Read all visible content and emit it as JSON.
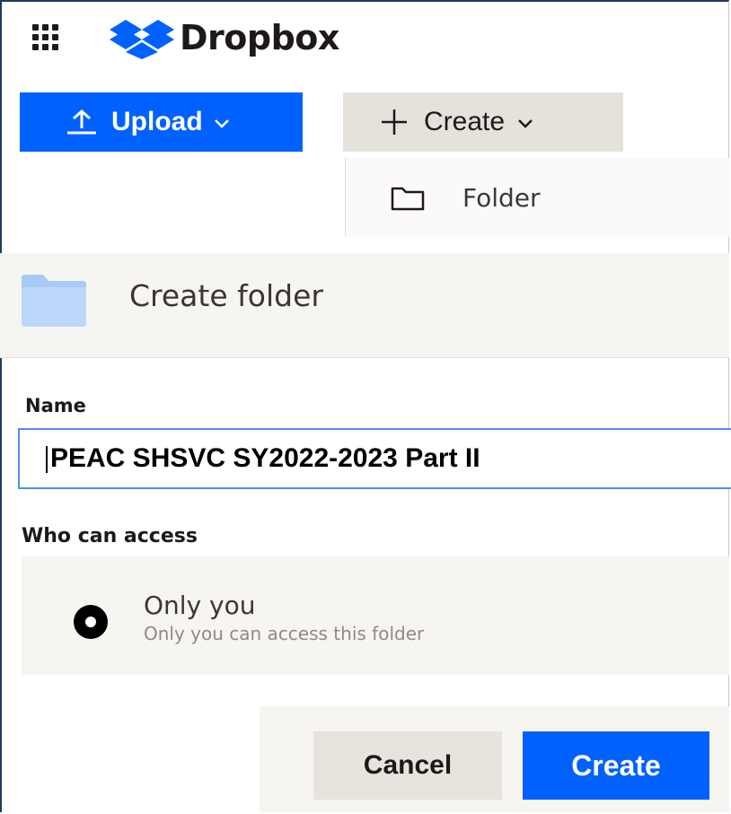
{
  "header": {
    "brand": "Dropbox",
    "brand_color": "#0061fe",
    "icons": [
      "app-grid-icon",
      "dropbox-logo-icon"
    ]
  },
  "toolbar": {
    "upload_label": "Upload",
    "create_label": "Create",
    "icons": [
      "upload-arrow-icon",
      "plus-icon",
      "chevron-down-icon"
    ]
  },
  "dropdown": {
    "items": [
      {
        "label": "Folder",
        "icon": "folder-outline-icon"
      }
    ]
  },
  "dialog": {
    "title": "Create folder",
    "name_label": "Name",
    "name_value": "PEAC SHSVC SY2022-2023 Part II",
    "access_label": "Who can access",
    "access_option": {
      "title": "Only you",
      "description": "Only you can access this folder",
      "selected": true
    },
    "cancel_label": "Cancel",
    "create_label": "Create"
  },
  "colors": {
    "primary": "#0061fe",
    "secondary_button": "#e5e2dc",
    "panel": "#f7f5f2",
    "folder": "#a7cbf6"
  }
}
